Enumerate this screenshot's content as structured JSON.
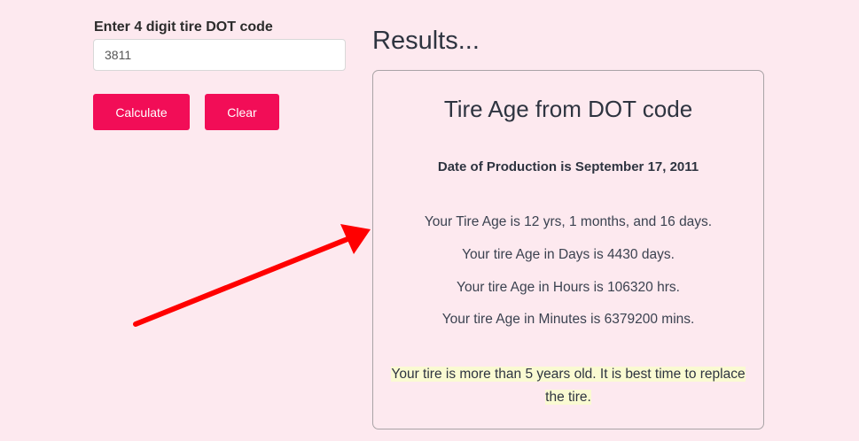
{
  "form": {
    "label": "Enter 4 digit tire DOT code",
    "dot_value": "3811",
    "calculate_label": "Calculate",
    "clear_label": "Clear"
  },
  "results": {
    "heading": "Results...",
    "title": "Tire Age from DOT code",
    "production_date": "Date of Production is September 17, 2011",
    "age_summary": "Your Tire Age is 12 yrs, 1 months, and 16 days.",
    "age_days": "Your tire Age in Days is 4430 days.",
    "age_hours": "Your tire Age in Hours is 106320 hrs.",
    "age_minutes": "Your tire Age in Minutes is 6379200 mins.",
    "advice": "Your tire is more than 5 years old. It is best time to replace the tire."
  },
  "colors": {
    "background": "#fde9ef",
    "button": "#f20d57",
    "arrow": "#ff0000",
    "advice_highlight": "#fafad2"
  },
  "icons": {
    "annotation": "red-arrow-icon"
  }
}
